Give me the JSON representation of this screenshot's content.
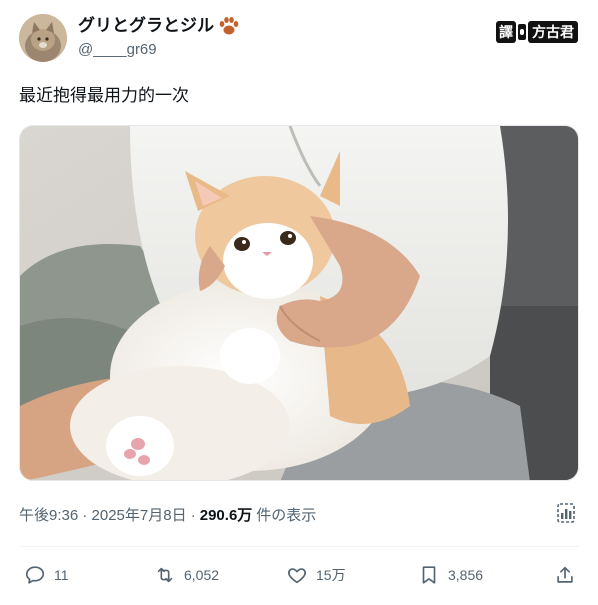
{
  "author": {
    "display_name": "グリとグラとジル",
    "handle": "@____gr69"
  },
  "watermark": {
    "part_a": "譯",
    "part_b": "方古君"
  },
  "tweet": {
    "text": "最近抱得最用力的一次"
  },
  "meta": {
    "time_date": "午後9:36 · 2025年7月8日 ·",
    "views": "290.6万",
    "views_suffix": "件の表示"
  },
  "actions": {
    "replies": "11",
    "retweets": "6,052",
    "likes": "15万",
    "bookmarks": "3,856"
  },
  "icons": [
    "paw-icon",
    "analytics-icon",
    "reply-icon",
    "retweet-icon",
    "like-icon",
    "bookmark-icon",
    "share-icon"
  ]
}
